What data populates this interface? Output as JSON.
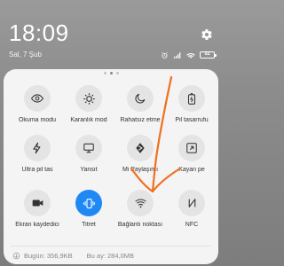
{
  "status": {
    "time": "18:09",
    "date": "Sal, 7 Şub",
    "battery": "92"
  },
  "tiles": [
    {
      "label": "Okuma modu",
      "icon": "eye-icon",
      "active": false
    },
    {
      "label": "Karanlık mod",
      "icon": "sun-icon",
      "active": false
    },
    {
      "label": "Rahatsız etme",
      "icon": "moon-icon",
      "active": false
    },
    {
      "label": "Pil tasarrufu",
      "icon": "battery-saver-icon",
      "active": false
    },
    {
      "label": "Ultra pil tas",
      "icon": "lightning-icon",
      "active": false
    },
    {
      "label": "Yansıt",
      "icon": "monitor-icon",
      "active": false
    },
    {
      "label": "Mi Paylaşımı",
      "icon": "share-icon",
      "active": false
    },
    {
      "label": "Kayan pe",
      "icon": "floating-window-icon",
      "active": false
    },
    {
      "label": "Ekran kaydedici",
      "icon": "video-camera-icon",
      "active": false
    },
    {
      "label": "Titret",
      "icon": "vibrate-icon",
      "active": true
    },
    {
      "label": "Bağlantı noktası",
      "icon": "hotspot-icon",
      "active": false
    },
    {
      "label": "NFC",
      "icon": "nfc-icon",
      "active": false
    }
  ],
  "data_usage": {
    "today": "Bugün: 356,9KB",
    "month": "Bu ay: 284,0MB"
  },
  "colors": {
    "accent": "#1e88f5",
    "annotation": "#f07020"
  }
}
